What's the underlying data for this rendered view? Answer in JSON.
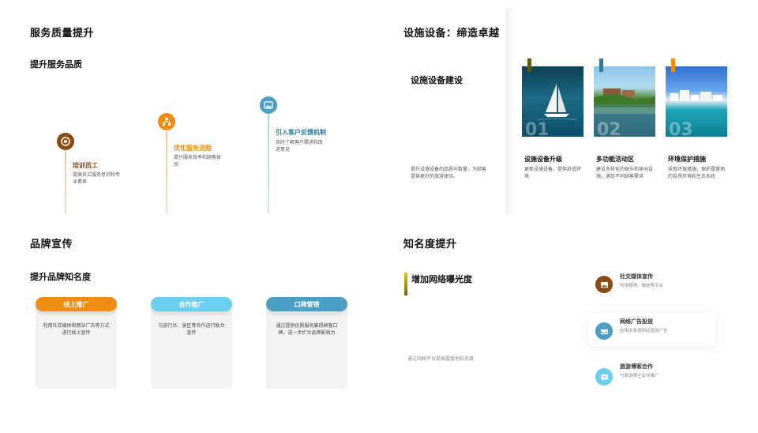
{
  "colors": {
    "brown": "#8a4a12",
    "orange": "#f08c12",
    "blue": "#4a9fc2",
    "lightblue": "#6ccff0",
    "olive": "#5a5a10",
    "teal": "#2e7a99"
  },
  "q1": {
    "title": "服务质量提升",
    "subtitle": "提升服务品质",
    "items": [
      {
        "title": "培训员工",
        "desc": "提高员工服务意识和专业素养",
        "icon": "target-icon"
      },
      {
        "title": "优化服务流程",
        "desc": "提升服务效率和顾客体验",
        "icon": "flowchart-icon"
      },
      {
        "title": "引入客户反馈机制",
        "desc": "及时了解客户需求和改进意见",
        "icon": "image-icon"
      }
    ]
  },
  "q2": {
    "title": "设施设备：缔造卓越",
    "subtitle": "设施设备建设",
    "desc": "提升设施设备的品质与数量，为顾客提供更好的旅游体验。",
    "cards": [
      {
        "num": "01",
        "title": "设施设备升级",
        "desc": "更新设施设备，提供舒适环境",
        "photo": "sailboat-photo"
      },
      {
        "num": "02",
        "title": "多功能活动区",
        "desc": "建设多样化的娱乐和休闲设施，满足不同顾客需求",
        "photo": "lake-house-photo"
      },
      {
        "num": "03",
        "title": "环境保护措施",
        "desc": "采取环保措施，保护露营地的自然环境和生态系统",
        "photo": "coastal-town-photo"
      }
    ]
  },
  "q3": {
    "title": "品牌宣传",
    "subtitle": "提升品牌知名度",
    "cards": [
      {
        "label": "线上推广",
        "desc": "利用社交媒体和网站广告等方式进行线上宣传"
      },
      {
        "label": "合作推广",
        "desc": "与旅行社、景区等合作进行联合宣传"
      },
      {
        "label": "口碑营销",
        "desc": "通过提供优质服务赢得顾客口碑，进一步扩大品牌影响力"
      }
    ]
  },
  "q4": {
    "title": "知名度提升",
    "subtitle": "增加网络曝光度",
    "desc": "通过网络平台提高露营地知名度",
    "items": [
      {
        "title": "社交媒体宣传",
        "desc": "利用微博、微信等平台",
        "icon": "image-icon"
      },
      {
        "title": "网络广告投放",
        "desc": "在相关旅游网站投放广告",
        "icon": "inbox-icon"
      },
      {
        "title": "旅游博客合作",
        "desc": "与旅游博主合作推广",
        "icon": "chat-icon"
      }
    ]
  }
}
